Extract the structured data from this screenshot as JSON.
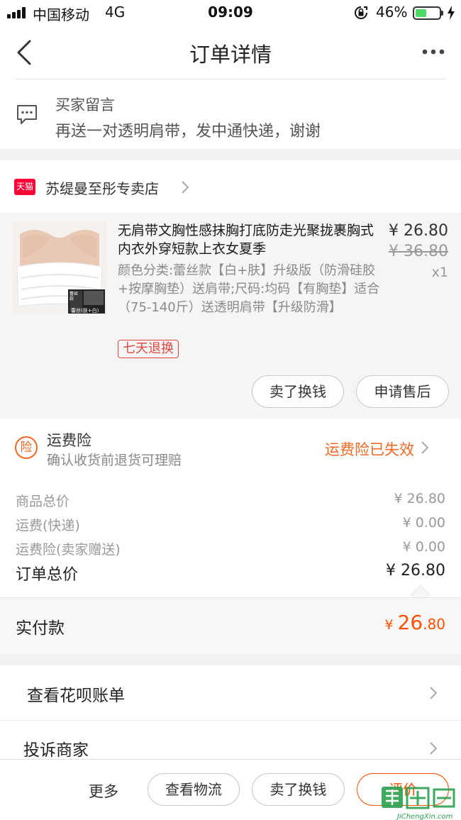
{
  "status_bar": {
    "carrier": "中国移动",
    "network": "4G",
    "time": "09:09",
    "battery_percent": "46%",
    "battery_level": 0.46
  },
  "nav": {
    "title": "订单详情"
  },
  "buyer_message": {
    "label": "买家留言",
    "text": "再送一对透明肩带，发中通快递，谢谢"
  },
  "shop": {
    "badge": "天猫",
    "name": "苏缇曼至彤专卖店"
  },
  "product": {
    "name": "无肩带文胸性感抹胸打底防走光聚拢裹胸式内衣外穿短款上衣女夏季",
    "spec": "颜色分类:蕾丝款【白+肤】升级版（防滑硅胶+按摩胸垫）送肩带;尺码:均码【有胸垫】适合（75-140斤）送透明肩带【升级防滑】",
    "price": "¥ 26.80",
    "original_price": "¥ 36.80",
    "quantity": "x1",
    "return_tag": "七天退换",
    "image_caption_top": "蕾丝款",
    "image_caption_bottom": "蕾丝(肤+白)",
    "buttons": {
      "sell": "卖了换钱",
      "after_sale": "申请售后"
    }
  },
  "insurance": {
    "icon_char": "险",
    "title": "运费险",
    "subtitle": "确认收货前退货可理赔",
    "status": "运费险已失效"
  },
  "summary": {
    "rows": [
      {
        "label": "商品总价",
        "value": "¥ 26.80"
      },
      {
        "label": "运费(快递)",
        "value": "¥ 0.00"
      },
      {
        "label": "运费险(卖家赠送)",
        "value": "¥ 0.00"
      }
    ],
    "total_label": "订单总价",
    "total_value": "¥ 26.80"
  },
  "paid": {
    "label": "实付款",
    "currency": "¥ ",
    "integer": "26",
    "decimal": ".80"
  },
  "links": {
    "huabei": "查看花呗账单",
    "complain": "投诉商家"
  },
  "bottom_bar": {
    "more": "更多",
    "logistics": "查看物流",
    "sell": "卖了换钱",
    "review": "评价"
  },
  "watermark": {
    "text": "JiChengXin.com"
  },
  "colors": {
    "accent_orange": "#ff5000",
    "tmall_red": "#ff0036",
    "battery_green": "#4cd964"
  }
}
